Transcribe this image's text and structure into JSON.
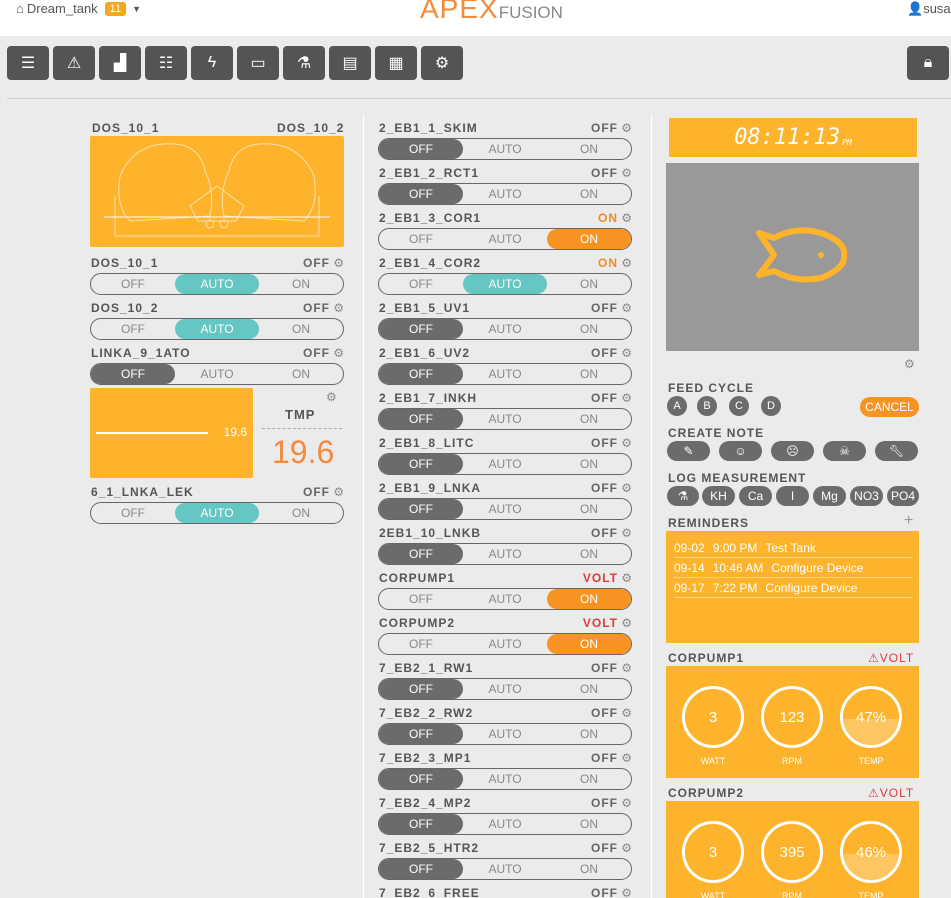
{
  "header": {
    "tank_name": "Dream_tank",
    "alert_count": "11",
    "logo_main": "APEX",
    "logo_sub": "FUSION",
    "user": "susa"
  },
  "toolbar": {
    "icons": [
      "list-icon",
      "alert-icon",
      "dashboard-icon",
      "tasks-icon",
      "power-icon",
      "calendar-icon",
      "flask-icon",
      "document-icon",
      "clipboard-icon",
      "gears-icon"
    ],
    "lock_icon": "lock-icon"
  },
  "left": {
    "dos_header_left": "DOS_10_1",
    "dos_header_right": "DOS_10_2",
    "switch_labels": {
      "off": "OFF",
      "auto": "AUTO",
      "on": "ON"
    },
    "outputs": [
      {
        "name": "DOS_10_1",
        "state": "OFF",
        "mode": "auto"
      },
      {
        "name": "DOS_10_2",
        "state": "OFF",
        "mode": "auto"
      },
      {
        "name": "LINKA_9_1ATO",
        "state": "OFF",
        "mode": "off"
      }
    ],
    "tmp_value": "19.6",
    "tmp_label": "TMP",
    "tmp_big": "19.6",
    "last_output": {
      "name": "6_1_LNKA_LEK",
      "state": "OFF",
      "mode": "auto"
    }
  },
  "middle": {
    "outputs": [
      {
        "name": "2_EB1_1_SKIM",
        "state": "OFF",
        "mode": "off"
      },
      {
        "name": "2_EB1_2_RCT1",
        "state": "OFF",
        "mode": "off"
      },
      {
        "name": "2_EB1_3_COR1",
        "state": "ON",
        "mode": "on"
      },
      {
        "name": "2_EB1_4_COR2",
        "state": "ON",
        "mode": "auto"
      },
      {
        "name": "2_EB1_5_UV1",
        "state": "OFF",
        "mode": "off"
      },
      {
        "name": "2_EB1_6_UV2",
        "state": "OFF",
        "mode": "off"
      },
      {
        "name": "2_EB1_7_INKH",
        "state": "OFF",
        "mode": "off"
      },
      {
        "name": "2_EB1_8_LITC",
        "state": "OFF",
        "mode": "off"
      },
      {
        "name": "2_EB1_9_LNKA",
        "state": "OFF",
        "mode": "off"
      },
      {
        "name": "2EB1_10_LNKB",
        "state": "OFF",
        "mode": "off"
      },
      {
        "name": "CORPUMP1",
        "state": "VOLT",
        "mode": "on"
      },
      {
        "name": "CORPUMP2",
        "state": "VOLT",
        "mode": "on"
      },
      {
        "name": "7_EB2_1_RW1",
        "state": "OFF",
        "mode": "off"
      },
      {
        "name": "7_EB2_2_RW2",
        "state": "OFF",
        "mode": "off"
      },
      {
        "name": "7_EB2_3_MP1",
        "state": "OFF",
        "mode": "off"
      },
      {
        "name": "7_EB2_4_MP2",
        "state": "OFF",
        "mode": "off"
      },
      {
        "name": "7_EB2_5_HTR2",
        "state": "OFF",
        "mode": "off"
      },
      {
        "name": "7_EB2_6_FREE",
        "state": "OFF",
        "mode": "off"
      }
    ]
  },
  "right": {
    "clock_time": "08:11:13",
    "clock_ampm": "PM",
    "feed_cycle_title": "FEED CYCLE",
    "feed_buttons": [
      "A",
      "B",
      "C",
      "D"
    ],
    "cancel_label": "CANCEL",
    "create_note_title": "CREATE NOTE",
    "note_icons": [
      "pencil-icon",
      "happy-face-icon",
      "sad-face-icon",
      "skull-icon",
      "wrench-icon"
    ],
    "log_measurement_title": "LOG MEASUREMENT",
    "log_buttons": [
      "flask",
      "KH",
      "Ca",
      "I",
      "Mg",
      "NO3",
      "PO4"
    ],
    "reminders_title": "REMINDERS",
    "reminders": [
      {
        "date": "09-02",
        "time": "9:00 PM",
        "text": "Test Tank"
      },
      {
        "date": "09-14",
        "time": "10:46 AM",
        "text": "Configure Device"
      },
      {
        "date": "09-17",
        "time": "7:22 PM",
        "text": "Configure Device"
      }
    ],
    "pumps": [
      {
        "name": "CORPUMP1",
        "alert": "VOLT",
        "watt": "3",
        "rpm": "123",
        "temp": "47%",
        "temp_fill": 0.47
      },
      {
        "name": "CORPUMP2",
        "alert": "VOLT",
        "watt": "3",
        "rpm": "395",
        "temp": "46%",
        "temp_fill": 0.46
      }
    ],
    "gauge_labels": {
      "watt": "WATT",
      "rpm": "RPM",
      "temp": "TEMP"
    }
  },
  "colors": {
    "accent_orange": "#fdb32b",
    "on_orange": "#f79323",
    "auto_teal": "#66c6c3",
    "off_gray": "#6b6b6b",
    "alert_red": "#e03a3a"
  }
}
